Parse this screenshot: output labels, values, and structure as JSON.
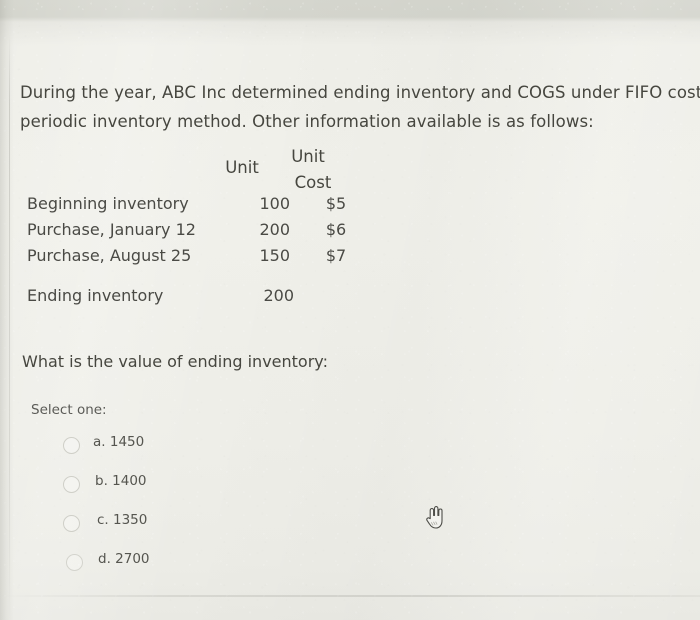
{
  "question_text": {
    "line1": "During the year, ABC Inc determined ending inventory and COGS under FIFO cost flow and",
    "line2": "periodic inventory method. Other information available is as follows:"
  },
  "table": {
    "headers": {
      "units": "Unit",
      "cost_line1": "Unit",
      "cost_line2": "Cost"
    },
    "rows": [
      {
        "label": "Beginning inventory",
        "units": "100",
        "cost": "$5"
      },
      {
        "label": "Purchase, January 12",
        "units": "200",
        "cost": "$6"
      },
      {
        "label": "Purchase, August 25",
        "units": "150",
        "cost": "$7"
      }
    ],
    "ending": {
      "label": "Ending inventory",
      "units": "200",
      "cost": ""
    }
  },
  "prompt": "What is the value of ending inventory:",
  "select_one_label": "Select one:",
  "options": [
    {
      "label": "a. 1450"
    },
    {
      "label": "b. 1400"
    },
    {
      "label": "c. 1350"
    },
    {
      "label": "d. 2700"
    }
  ],
  "cursor": {
    "icon": "pointing-hand-cursor"
  },
  "colors": {
    "background": "#eeeeea",
    "top_band": "#d4d5cd",
    "text": "#46463f",
    "radio_outline": "#cfcfc8"
  }
}
